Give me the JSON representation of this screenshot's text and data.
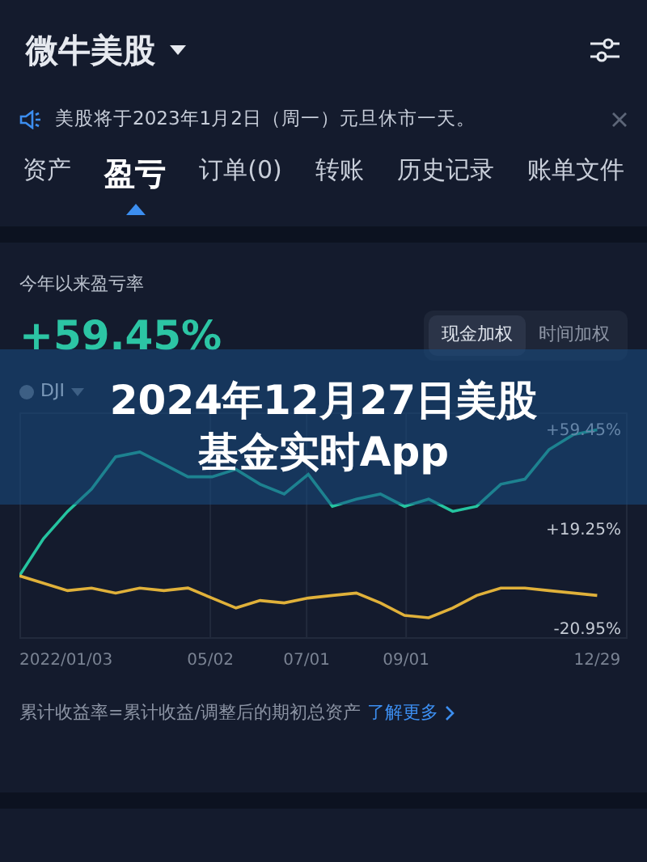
{
  "header": {
    "title": "微牛美股"
  },
  "notice": {
    "text": "美股将于2023年1月2日（周一）元旦休市一天。"
  },
  "tabs": [
    {
      "label": "资产",
      "selected": false
    },
    {
      "label": "盈亏",
      "selected": true
    },
    {
      "label": "订单(0)",
      "selected": false
    },
    {
      "label": "转账",
      "selected": false
    },
    {
      "label": "历史记录",
      "selected": false
    },
    {
      "label": "账单文件",
      "selected": false
    }
  ],
  "summary": {
    "label": "今年以来盈亏率",
    "value": "+59.45%"
  },
  "weighting": [
    {
      "label": "现金加权",
      "selected": true
    },
    {
      "label": "时间加权",
      "selected": false
    }
  ],
  "chart": {
    "chart_data": {
      "type": "line",
      "x": [
        "2022-01-03",
        "2022-01-18",
        "2022-02-02",
        "2022-02-17",
        "2022-03-04",
        "2022-03-19",
        "2022-04-03",
        "2022-04-18",
        "2022-05-03",
        "2022-05-18",
        "2022-06-02",
        "2022-06-17",
        "2022-07-02",
        "2022-07-17",
        "2022-08-01",
        "2022-08-16",
        "2022-08-31",
        "2022-09-15",
        "2022-09-30",
        "2022-10-15",
        "2022-10-30",
        "2022-11-14",
        "2022-11-29",
        "2022-12-14",
        "2022-12-29"
      ],
      "series": [
        {
          "color": "#25c4a0",
          "values": [
            0,
            15,
            26,
            35,
            48,
            50,
            45,
            40,
            40,
            43,
            37,
            33,
            41,
            28,
            31,
            33,
            28,
            31,
            26,
            28,
            37,
            39,
            51,
            57,
            59
          ]
        },
        {
          "name": "DJI",
          "color": "#e0b13a",
          "values": [
            0,
            -3,
            -6,
            -5,
            -7,
            -5,
            -6,
            -5,
            -9,
            -13,
            -10,
            -11,
            -9,
            -8,
            -7,
            -11,
            -16,
            -17,
            -13,
            -8,
            -5,
            -5,
            -6,
            -7,
            -8
          ]
        }
      ],
      "xlim": [
        "2022-01-03",
        "2023-01-17"
      ],
      "ylim": [
        -25.5,
        66
      ],
      "grid": true,
      "xticks": [
        {
          "value": "2022-01-03",
          "label": "2022/01/03"
        },
        {
          "value": "2022-05-02",
          "label": "05/02"
        },
        {
          "value": "2022-07-01",
          "label": "07/01"
        },
        {
          "value": "2022-09-01",
          "label": "09/01"
        },
        {
          "value": "2022-12-29",
          "label": "12/29"
        }
      ],
      "yticks": [
        {
          "value": 59.45,
          "label": "+59.45%"
        },
        {
          "value": 19.25,
          "label": "+19.25%"
        },
        {
          "value": -20.95,
          "label": "-20.95%"
        }
      ]
    }
  },
  "footnote": {
    "text": "累计收益率=累计收益/调整后的期初总资产",
    "link": "了解更多"
  },
  "banner": {
    "lines": [
      "2024年12月27日美股",
      "基金实时App"
    ]
  }
}
